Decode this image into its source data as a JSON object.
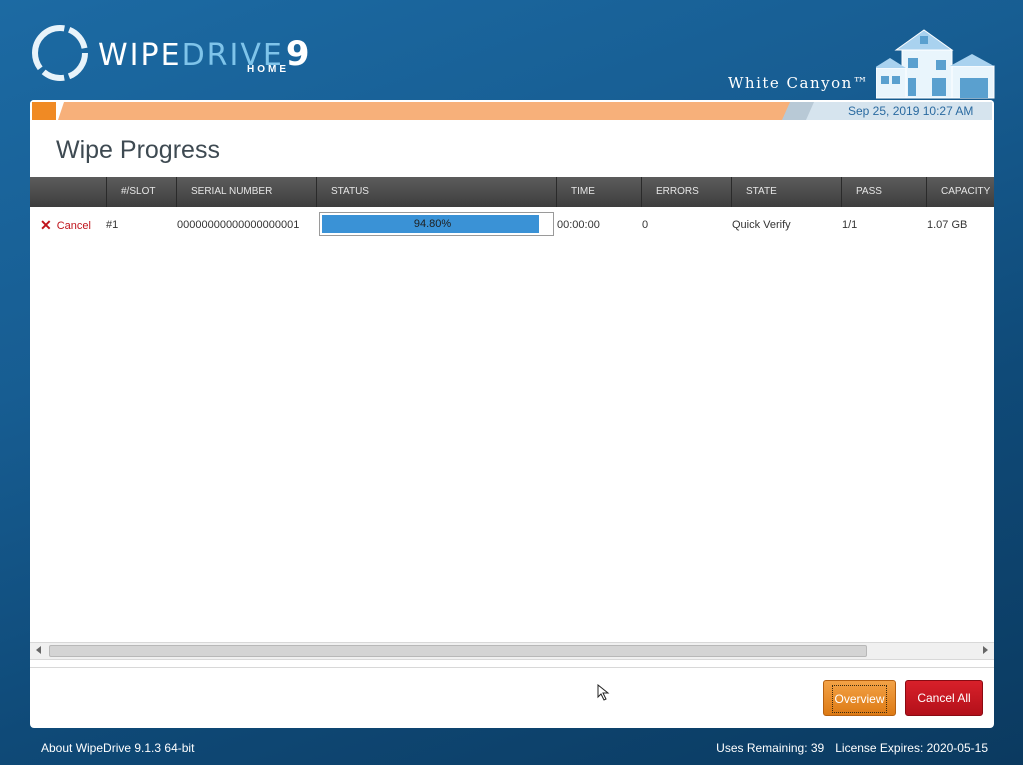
{
  "app": {
    "brand_wipe": "WIPE",
    "brand_drive": "DRIVE",
    "brand_version": "9",
    "brand_edition": "HOME",
    "company": "White Canyon™",
    "datetime": "Sep 25, 2019 10:27 AM"
  },
  "page": {
    "title": "Wipe Progress"
  },
  "table": {
    "columns": [
      "#/SLOT",
      "SERIAL NUMBER",
      "STATUS",
      "TIME",
      "ERRORS",
      "STATE",
      "PASS",
      "CAPACITY"
    ],
    "rows": [
      {
        "action": "Cancel",
        "slot": "#1",
        "serial": "00000000000000000001",
        "progress_label": "94.80%",
        "progress_fraction": 0.948,
        "time": "00:00:00",
        "errors": "0",
        "state": "Quick Verify",
        "pass": "1/1",
        "capacity": "1.07 GB"
      }
    ]
  },
  "buttons": {
    "overview": "Overview",
    "cancel_all": "Cancel All"
  },
  "footer": {
    "about": "About WipeDrive 9.1.3 64-bit",
    "uses_remaining": "Uses Remaining: 39",
    "license_expires": "License Expires: 2020-05-15"
  },
  "colors": {
    "accent_orange": "#f08a24",
    "progress_blue": "#3a92d6",
    "cancel_red": "#c0141c"
  },
  "icons": [
    "logo-ring-icon",
    "house-icon",
    "close-icon",
    "arrow-left-icon",
    "arrow-right-icon",
    "mouse-cursor-icon"
  ]
}
